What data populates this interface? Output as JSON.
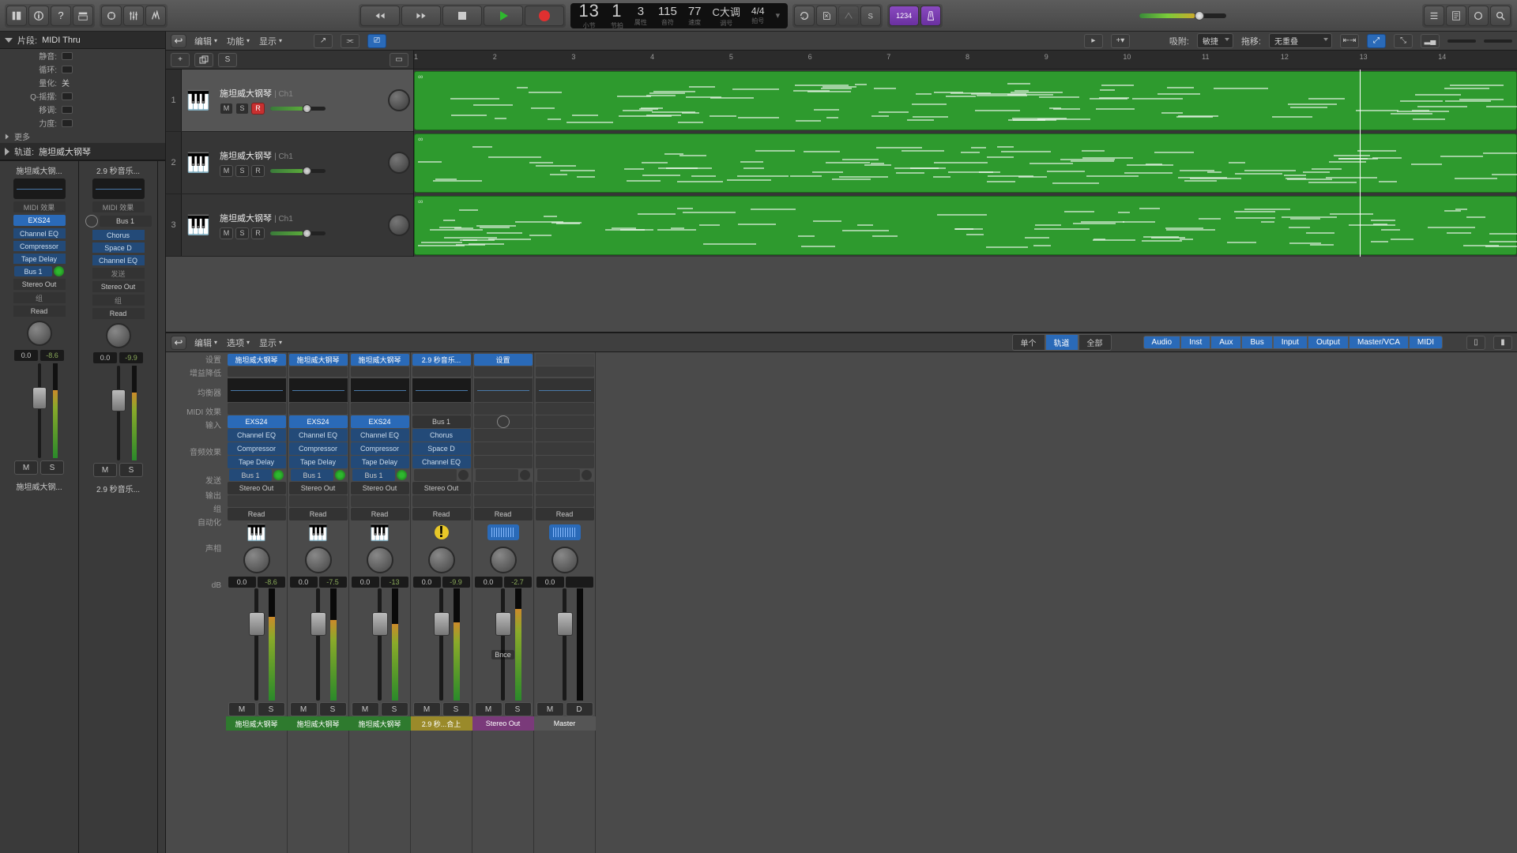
{
  "toolbar": {
    "lcd": {
      "bars": "13",
      "beats": "1",
      "sub1": "3",
      "sub2": "115",
      "tempo": "77",
      "key": "C大调",
      "timesig": "4/4",
      "lbl_bar": "小节",
      "lbl_beat": "节拍",
      "lbl_div": "属性",
      "lbl_tick": "音符",
      "lbl_tempo": "速度",
      "lbl_key": "调号",
      "lbl_ts": "拍号"
    },
    "numbers": "1234"
  },
  "inspector": {
    "region_hd": "片段:",
    "region_name": "MIDI Thru",
    "rows": [
      {
        "lbl": "静音:",
        "val": ""
      },
      {
        "lbl": "循环:",
        "val": ""
      },
      {
        "lbl": "量化:",
        "val": "关"
      },
      {
        "lbl": "Q-摇摆:",
        "val": ""
      },
      {
        "lbl": "移调:",
        "val": ""
      },
      {
        "lbl": "力度:",
        "val": ""
      }
    ],
    "more": "更多",
    "track_hd": "轨道:",
    "track_name": "施坦威大钢琴"
  },
  "arrange": {
    "menus": [
      "编辑",
      "功能",
      "显示"
    ],
    "snap_lbl": "吸附:",
    "snap_val": "敏捷",
    "drag_lbl": "拖移:",
    "drag_val": "无重叠",
    "ruler": [
      1,
      2,
      3,
      4,
      5,
      6,
      7,
      8,
      9,
      10,
      11,
      12,
      13,
      14
    ],
    "playhead_bar": 13,
    "tracks": [
      {
        "n": "1",
        "name": "施坦威大钢琴",
        "ch": "Ch1",
        "selected": true,
        "rec": true
      },
      {
        "n": "2",
        "name": "施坦威大钢琴",
        "ch": "Ch1",
        "selected": false,
        "rec": false
      },
      {
        "n": "3",
        "name": "施坦威大钢琴",
        "ch": "Ch1",
        "selected": false,
        "rec": false
      }
    ],
    "msr": {
      "m": "M",
      "s": "S",
      "r": "R"
    },
    "header": {
      "plus": "+",
      "solo": "S"
    }
  },
  "left_strips": [
    {
      "name": "施坦威大钢...",
      "inst": "EXS24",
      "fx": [
        "Channel EQ",
        "Compressor",
        "Tape Delay"
      ],
      "send": "Bus 1",
      "out": "Stereo Out",
      "read": "Read",
      "db": "0.0",
      "peak": "-8.6",
      "ms": [
        "M",
        "S"
      ]
    },
    {
      "name": "2.9 秒音乐...",
      "inst": "Bus 1",
      "fx": [
        "Chorus",
        "Space D",
        "Channel EQ"
      ],
      "send": "发送",
      "out": "Stereo Out",
      "read": "Read",
      "db": "0.0",
      "peak": "-9.9",
      "ms": [
        "M",
        "S"
      ]
    }
  ],
  "left_labels": {
    "midifx": "MIDI 效果",
    "group": "组"
  },
  "mixer": {
    "menus": [
      "编辑",
      "选项",
      "显示"
    ],
    "view_tabs": [
      "单个",
      "轨道",
      "全部"
    ],
    "view_sel": 1,
    "type_tabs": [
      "Audio",
      "Inst",
      "Aux",
      "Bus",
      "Input",
      "Output",
      "Master/VCA",
      "MIDI"
    ],
    "row_labels": [
      "设置",
      "增益降低",
      "均衡器",
      "MIDI 效果",
      "输入",
      "音频效果",
      "发送",
      "输出",
      "组",
      "自动化",
      "声相",
      "dB"
    ],
    "strips": [
      {
        "name": "施坦威大钢琴",
        "input": "EXS24",
        "fx": [
          "Channel EQ",
          "Compressor",
          "Tape Delay"
        ],
        "send": "Bus 1",
        "out": "Stereo Out",
        "read": "Read",
        "icon": "piano",
        "db": "0.0",
        "peak": "-8.6",
        "fader": 30,
        "meter": 75,
        "foot": "施坦威大钢琴",
        "foot_cls": "ft-green",
        "eq": true
      },
      {
        "name": "施坦威大钢琴",
        "input": "EXS24",
        "fx": [
          "Channel EQ",
          "Compressor",
          "Tape Delay"
        ],
        "send": "Bus 1",
        "out": "Stereo Out",
        "read": "Read",
        "icon": "piano",
        "db": "0.0",
        "peak": "-7.5",
        "fader": 30,
        "meter": 72,
        "foot": "施坦威大钢琴",
        "foot_cls": "ft-green",
        "eq": true
      },
      {
        "name": "施坦威大钢琴",
        "input": "EXS24",
        "fx": [
          "Channel EQ",
          "Compressor",
          "Tape Delay"
        ],
        "send": "Bus 1",
        "out": "Stereo Out",
        "read": "Read",
        "icon": "piano",
        "db": "0.0",
        "peak": "-13",
        "fader": 30,
        "meter": 68,
        "foot": "施坦威大钢琴",
        "foot_cls": "ft-green",
        "eq": true
      },
      {
        "name": "2.9 秒音乐...",
        "input": "Bus 1",
        "fx": [
          "Chorus",
          "Space D",
          "Channel EQ"
        ],
        "send": "",
        "out": "Stereo Out",
        "read": "Read",
        "icon": "warn",
        "db": "0.0",
        "peak": "-9.9",
        "fader": 30,
        "meter": 70,
        "foot": "2.9 秒...合上",
        "foot_cls": "ft-yellow",
        "eq": true,
        "input_gray": true
      },
      {
        "name": "设置",
        "input": "",
        "fx": [],
        "send": "",
        "out": "",
        "read": "Read",
        "icon": "audio",
        "db": "0.0",
        "peak": "-2.7",
        "fader": 30,
        "meter": 82,
        "foot": "Stereo Out",
        "foot_cls": "ft-purple",
        "io": true,
        "bnce": "Bnce",
        "eq": false
      },
      {
        "name": "",
        "input": "",
        "fx": [],
        "send": "",
        "out": "",
        "read": "Read",
        "icon": "audio",
        "db": "0.0",
        "peak": "",
        "fader": 30,
        "meter": 0,
        "foot": "Master",
        "foot_cls": "ft-gray",
        "ms": [
          "M",
          "D"
        ],
        "eq": false
      }
    ]
  }
}
